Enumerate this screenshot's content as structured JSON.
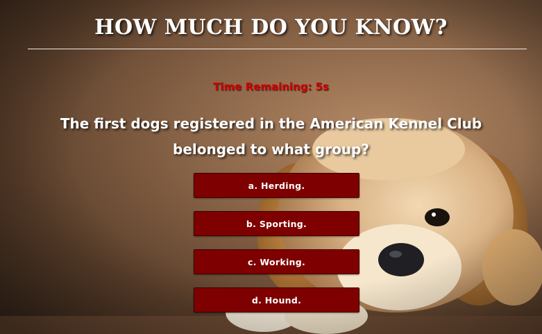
{
  "header": {
    "title": "HOW MUCH DO YOU KNOW?"
  },
  "quiz": {
    "timer_text": "Time Remaining: 5s",
    "question": "The first dogs registered in the American Kennel Club belonged to what group?",
    "answers": [
      {
        "label": "a. Herding."
      },
      {
        "label": "b. Sporting."
      },
      {
        "label": "c. Working."
      },
      {
        "label": "d. Hound."
      }
    ]
  },
  "colors": {
    "timer": "#d10000",
    "answer_button": "#7e0000",
    "title": "#ffffff"
  },
  "background": {
    "subject": "golden-retriever-puppy"
  }
}
